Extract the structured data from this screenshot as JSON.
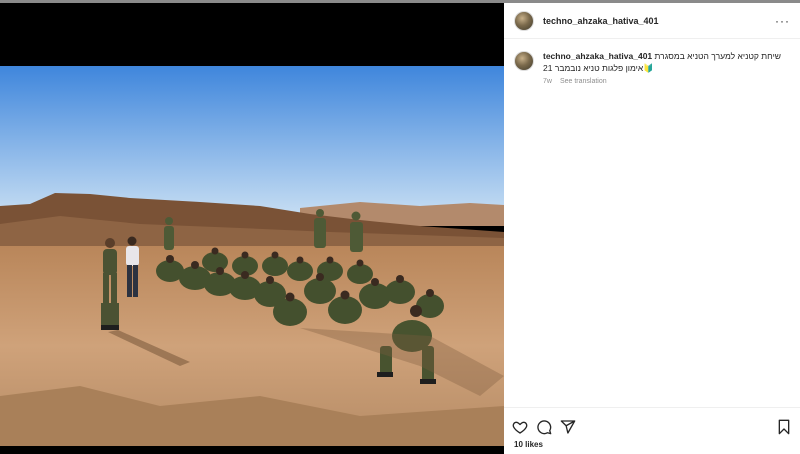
{
  "post": {
    "username": "techno_ahzaka_hativa_401",
    "more_icon": "more-horizontal-icon",
    "caption": {
      "username": "techno_ahzaka_hativa_401",
      "text_line1": "שיחת קטניא למערך הטניא במסגרת",
      "text_line2": "אימון פלגות טניא נובמבר 21",
      "emoji": "🔰",
      "time_ago": "7w",
      "see_translation": "See translation"
    },
    "actions": {
      "like_icon": "heart-icon",
      "comment_icon": "comment-icon",
      "share_icon": "send-icon",
      "save_icon": "bookmark-icon"
    },
    "likes": "10 likes"
  },
  "colors": {
    "sky_top": "#4a8ede",
    "sky_bottom": "#bcd9f2",
    "ground": "#c3966b",
    "uniform": "#4a5232"
  }
}
